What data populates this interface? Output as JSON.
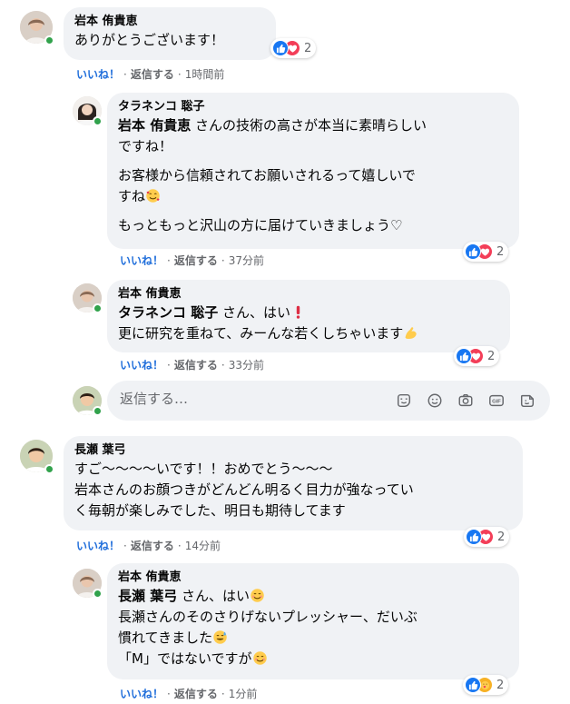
{
  "comments": [
    {
      "author": "岩本 侑貴恵",
      "lines": [
        "ありがとうございます！"
      ],
      "reaction_count": "2",
      "like_label": "いいね！",
      "reply_label": "返信する",
      "time": "1時間前"
    },
    {
      "author": "タラネンコ 聡子",
      "mention": "岩本 侑貴恵",
      "line1_rest": " さんの技術の高さが本当に素晴らしい",
      "line2": "ですね！",
      "line3": "お客様から信頼されてお願いされるって嬉しいで",
      "line4": "すね",
      "line5": "もっともっと沢山の方に届けていきましょう♡",
      "reaction_count": "2",
      "like_label": "いいね！",
      "reply_label": "返信する",
      "time": "37分前"
    },
    {
      "author": "岩本 侑貴恵",
      "mention": "タラネンコ 聡子",
      "line1_rest": " さん、はい",
      "line2": "更に研究を重ねて、みーんな若くしちゃいます",
      "reaction_count": "2",
      "like_label": "いいね！",
      "reply_label": "返信する",
      "time": "33分前"
    },
    {
      "author": "長瀬 葉弓",
      "line1": "すご〜〜〜〜いです！！おめでとう〜〜〜",
      "line2": "岩本さんのお顔つきがどんどん明るく目力が強なってい",
      "line3": "く毎朝が楽しみでした、明日も期待してます",
      "reaction_count": "2",
      "like_label": "いいね！",
      "reply_label": "返信する",
      "time": "14分前"
    },
    {
      "author": "岩本 侑貴恵",
      "mention": "長瀬 葉弓",
      "line1_rest": " さん、はい",
      "line2": "長瀬さんのそのさりげないプレッシャー、だいぶ",
      "line3": "慣れてきました",
      "line4": "「M」ではないですが",
      "reaction_count": "2",
      "like_label": "いいね！",
      "reply_label": "返信する",
      "time": "1分前"
    }
  ],
  "reply_box": {
    "placeholder": "返信する…",
    "icons": [
      "sticker-face-icon",
      "emoji-icon",
      "camera-icon",
      "gif-icon",
      "sticker-icon"
    ]
  },
  "colors": {
    "like_blue": "#216fdb",
    "bubble_bg": "#f0f2f5",
    "online_green": "#31a24c",
    "love_red": "#f33e58"
  }
}
